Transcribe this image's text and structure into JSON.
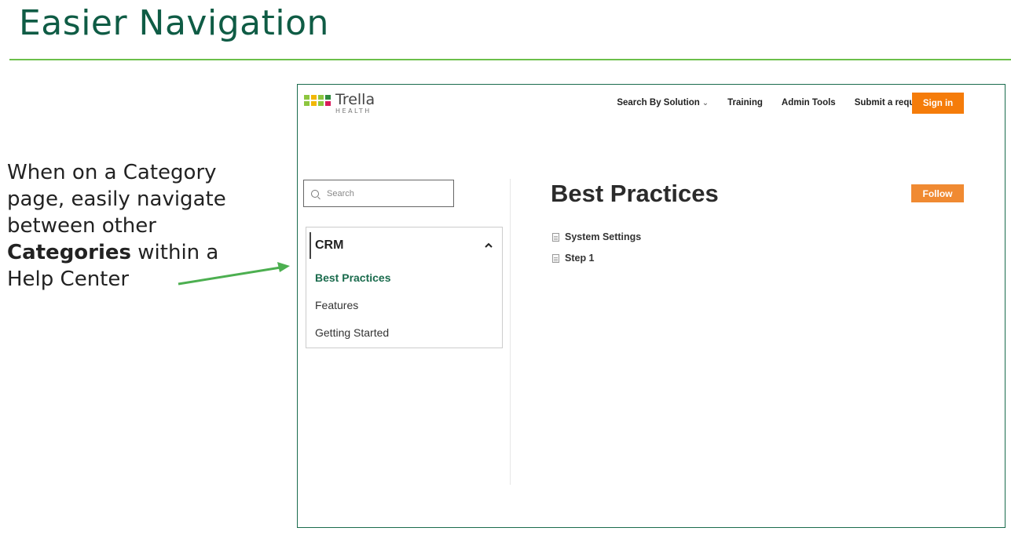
{
  "slide": {
    "title": "Easier Navigation",
    "callout_line1": "When on a Category",
    "callout_line2": "page, easily navigate",
    "callout_line3": "between other",
    "callout_bold": "Categories",
    "callout_line4_rest": " within a",
    "callout_line5": "Help Center",
    "accent_color": "#0f5c45",
    "rule_color": "#6cbf4a",
    "arrow_color": "#4caf50"
  },
  "site": {
    "logo_name": "Trella",
    "logo_sub": "HEALTH",
    "logo_colors": [
      "#8dc63f",
      "#f2b705",
      "#2e8b3e",
      "#d91a5b"
    ],
    "nav": {
      "search_by_solution": "Search By Solution",
      "training": "Training",
      "admin_tools": "Admin Tools",
      "submit_request": "Submit a request",
      "sign_in": "Sign in"
    },
    "search": {
      "placeholder": "Search"
    },
    "category_nav": {
      "heading": "CRM",
      "items": [
        "Best Practices",
        "Features",
        "Getting Started"
      ],
      "active_index": 0
    },
    "main": {
      "title": "Best Practices",
      "follow_label": "Follow",
      "articles": [
        "System Settings",
        "Step 1"
      ]
    },
    "brand_orange": "#f57c0a"
  }
}
